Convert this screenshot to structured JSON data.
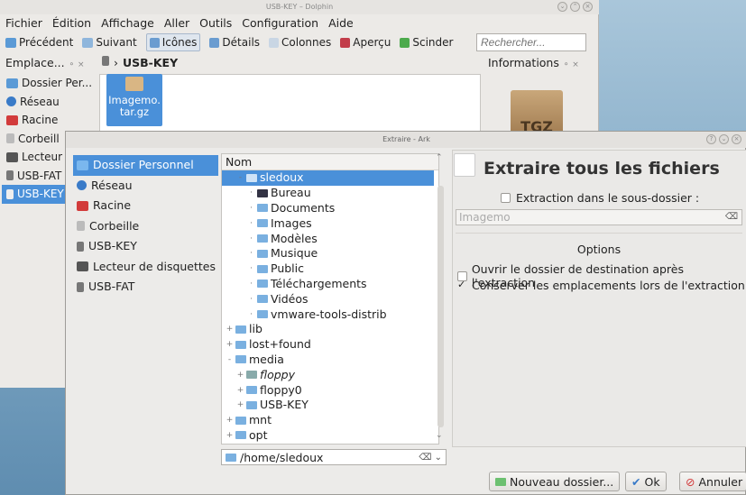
{
  "dolphin": {
    "title": "USB-KEY – Dolphin",
    "menu": [
      "Fichier",
      "Édition",
      "Affichage",
      "Aller",
      "Outils",
      "Configuration",
      "Aide"
    ],
    "toolbar": {
      "back": "Précédent",
      "forward": "Suivant",
      "icons": "Icônes",
      "details": "Détails",
      "columns": "Colonnes",
      "preview": "Aperçu",
      "split": "Scinder"
    },
    "search_placeholder": "Rechercher...",
    "places_header": "Emplace...",
    "places": [
      "Dossier Per...",
      "Réseau",
      "Racine",
      "Corbeill",
      "Lecteur",
      "USB-FAT",
      "USB-KEY"
    ],
    "breadcrumb": "USB-KEY",
    "file_name": "Imagemo. tar.gz",
    "info_header": "Informations",
    "box_label": "TGZ"
  },
  "ark": {
    "title": "Extraire - Ark",
    "places": [
      "Dossier Personnel",
      "Réseau",
      "Racine",
      "Corbeille",
      "USB-KEY",
      "Lecteur de disquettes",
      "USB-FAT"
    ],
    "tree_header": "Nom",
    "tree": [
      {
        "label": "sledoux",
        "level": 1,
        "exp": "-",
        "sel": true
      },
      {
        "label": "Bureau",
        "level": 2,
        "exp": "·"
      },
      {
        "label": "Documents",
        "level": 2,
        "exp": "·"
      },
      {
        "label": "Images",
        "level": 2,
        "exp": "·"
      },
      {
        "label": "Modèles",
        "level": 2,
        "exp": "·"
      },
      {
        "label": "Musique",
        "level": 2,
        "exp": "·"
      },
      {
        "label": "Public",
        "level": 2,
        "exp": "·"
      },
      {
        "label": "Téléchargements",
        "level": 2,
        "exp": "·"
      },
      {
        "label": "Vidéos",
        "level": 2,
        "exp": "·"
      },
      {
        "label": "vmware-tools-distrib",
        "level": 2,
        "exp": "·"
      },
      {
        "label": "lib",
        "level": 0,
        "exp": "+"
      },
      {
        "label": "lost+found",
        "level": 0,
        "exp": "+"
      },
      {
        "label": "media",
        "level": 0,
        "exp": "-"
      },
      {
        "label": "floppy",
        "level": 1,
        "exp": "+",
        "italic": true
      },
      {
        "label": "floppy0",
        "level": 1,
        "exp": "+"
      },
      {
        "label": "USB-KEY",
        "level": 1,
        "exp": "+"
      },
      {
        "label": "mnt",
        "level": 0,
        "exp": "+"
      },
      {
        "label": "opt",
        "level": 0,
        "exp": "+"
      }
    ],
    "path": "/home/sledoux",
    "heading": "Extraire tous les fichiers",
    "subfolder_label": "Extraction dans le sous-dossier :",
    "subfolder_value": "Imagemo",
    "options_title": "Options",
    "open_dest": "Ouvrir le dossier de destination après l'extraction",
    "keep_paths": "Conserver les emplacements lors de l'extraction",
    "new_folder": "Nouveau dossier...",
    "ok": "Ok",
    "cancel": "Annuler"
  },
  "colors": {
    "accent": "#4a90d9",
    "folder": "#7ab0e0"
  }
}
